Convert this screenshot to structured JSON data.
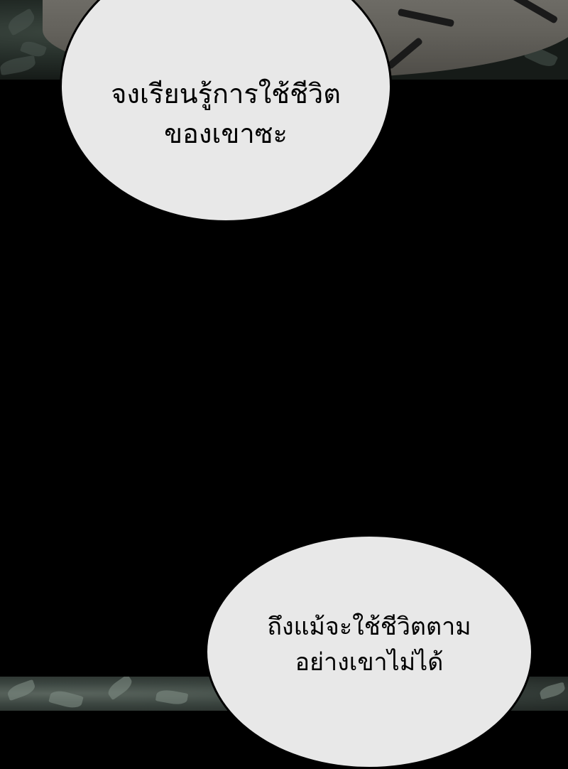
{
  "bubbles": [
    {
      "line1": "จงเรียนรู้การใช้ชีวิต",
      "line2": "ของเขาซะ"
    },
    {
      "line1": "ถึงแม้จะใช้ชีวิตตาม",
      "line2": "อย่างเขาไม่ได้"
    }
  ],
  "colors": {
    "background": "#000000",
    "bubble_fill": "#e8e8e8",
    "bubble_outline": "#000000"
  }
}
